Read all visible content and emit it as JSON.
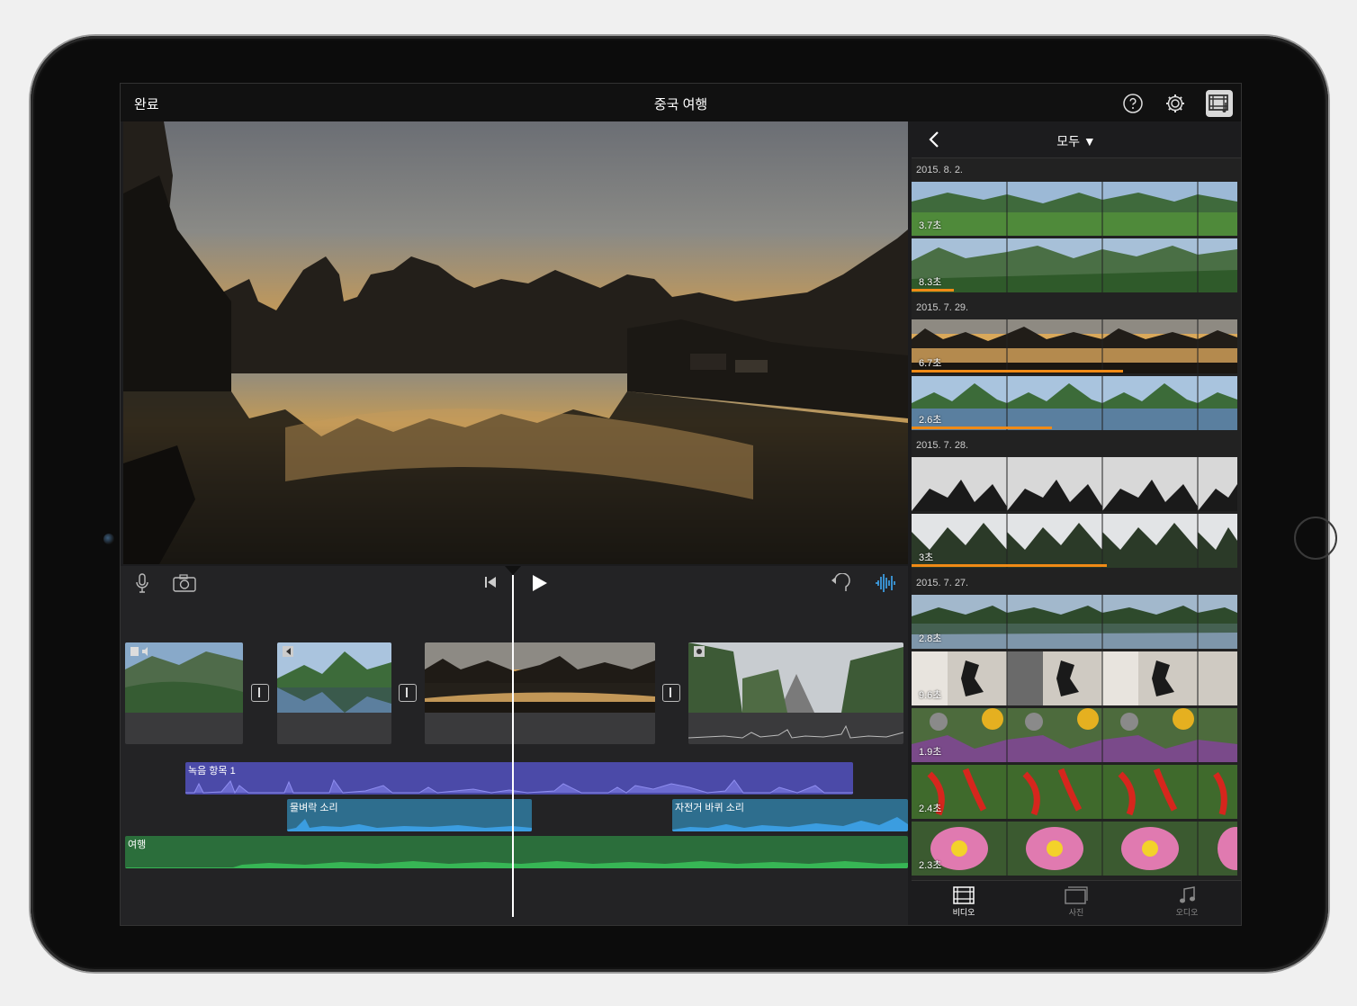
{
  "topbar": {
    "done_label": "완료",
    "project_title": "중국 여행"
  },
  "icons": {
    "help": "help-icon",
    "settings": "gear-icon",
    "media_browser": "media-icon",
    "microphone": "microphone-icon",
    "camera": "camera-icon",
    "skip_back": "skip-back-icon",
    "play": "play-icon",
    "undo": "undo-icon",
    "audio_waveform": "waveform-icon",
    "back": "chevron-left-icon"
  },
  "timeline": {
    "audio_tracks": [
      {
        "label": "녹음 항목 1",
        "color": "#4b4aa8"
      },
      {
        "label": "물벼락 소리",
        "color": "#2e6e8e"
      },
      {
        "label": "자전거 바퀴 소리",
        "color": "#2e6e8e"
      },
      {
        "label": "여행",
        "color": "#2b6e3b"
      }
    ]
  },
  "browser": {
    "filter_label": "모두 ▼",
    "groups": [
      {
        "date": "2015. 8. 2.",
        "clips": [
          {
            "duration": "3.7초",
            "used": 0
          },
          {
            "duration": "8.3초",
            "used": 0.13
          }
        ]
      },
      {
        "date": "2015. 7. 29.",
        "clips": [
          {
            "duration": "6.7초",
            "used": 0.65
          },
          {
            "duration": "2.6초",
            "used": 0.43
          }
        ]
      },
      {
        "date": "2015. 7. 28.",
        "clips": [
          {
            "duration": "",
            "used": 0
          },
          {
            "duration": "3초",
            "used": 0.6
          }
        ]
      },
      {
        "date": "2015. 7. 27.",
        "clips": [
          {
            "duration": "2.8초",
            "used": 0
          },
          {
            "duration": "9.6초",
            "used": 0
          },
          {
            "duration": "1.9초",
            "used": 0
          },
          {
            "duration": "2.4초",
            "used": 0
          },
          {
            "duration": "2.3초",
            "used": 0
          }
        ]
      }
    ],
    "tabs": [
      {
        "label": "비디오",
        "active": true
      },
      {
        "label": "사진",
        "active": false
      },
      {
        "label": "오디오",
        "active": false
      }
    ]
  },
  "colors": {
    "accent_orange": "#f08a16",
    "waveform_blue": "#3fa9f5"
  }
}
